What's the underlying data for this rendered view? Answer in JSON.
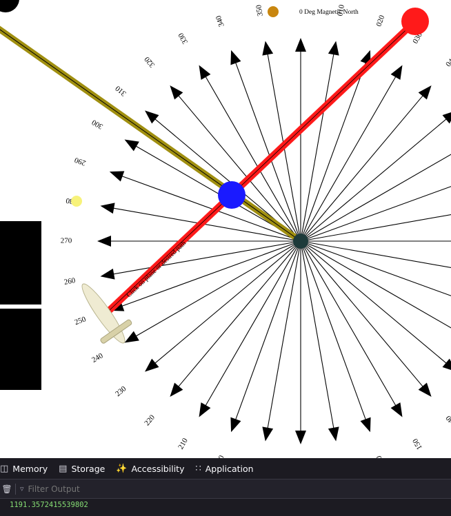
{
  "compass": {
    "north_label": "0 Deg Magnetic North",
    "degree_labels": [
      {
        "deg": 10,
        "text": "010"
      },
      {
        "deg": 20,
        "text": "020"
      },
      {
        "deg": 30,
        "text": "030"
      },
      {
        "deg": 40,
        "text": "040"
      },
      {
        "deg": 140,
        "text": "140"
      },
      {
        "deg": 150,
        "text": "150"
      },
      {
        "deg": 160,
        "text": "160"
      },
      {
        "deg": 170,
        "text": "17"
      },
      {
        "deg": 180,
        "text": "1"
      },
      {
        "deg": 190,
        "text": "0"
      },
      {
        "deg": 200,
        "text": "200"
      },
      {
        "deg": 210,
        "text": "210"
      },
      {
        "deg": 220,
        "text": "220"
      },
      {
        "deg": 230,
        "text": "230"
      },
      {
        "deg": 240,
        "text": "240"
      },
      {
        "deg": 250,
        "text": "250"
      },
      {
        "deg": 260,
        "text": "260"
      },
      {
        "deg": 270,
        "text": "270"
      },
      {
        "deg": 280,
        "text": "80"
      },
      {
        "deg": 290,
        "text": "290"
      },
      {
        "deg": 300,
        "text": "300"
      },
      {
        "deg": 310,
        "text": "310"
      },
      {
        "deg": 320,
        "text": "320"
      },
      {
        "deg": 330,
        "text": "330"
      },
      {
        "deg": 340,
        "text": "340"
      },
      {
        "deg": 350,
        "text": "350"
      }
    ],
    "heading_line_label": "Click on plane or desired path",
    "colors": {
      "heading_line": "#ff1a1a",
      "olive_line": "#a08f10",
      "red_dot": "#ff1a1a",
      "blue_dot": "#1a1aff",
      "orange_dot": "#c8860f",
      "yellow_dot": "#f7f27a",
      "arrows": "#000000"
    }
  },
  "devtools": {
    "tabs": [
      {
        "label": "Memory",
        "icon": "memory-icon"
      },
      {
        "label": "Storage",
        "icon": "storage-icon"
      },
      {
        "label": "Accessibility",
        "icon": "accessibility-icon"
      },
      {
        "label": "Application",
        "icon": "application-icon"
      }
    ],
    "filter_placeholder": "Filter Output",
    "console_output": "1191.3572415539802"
  }
}
